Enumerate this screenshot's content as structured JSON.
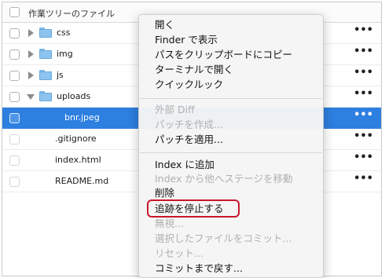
{
  "header": {
    "title": "作業ツリーのファイル"
  },
  "files": [
    {
      "name": "css",
      "type": "folder",
      "expanded": false
    },
    {
      "name": "img",
      "type": "folder",
      "expanded": false
    },
    {
      "name": "js",
      "type": "folder",
      "expanded": false
    },
    {
      "name": "uploads",
      "type": "folder",
      "expanded": true
    },
    {
      "name": "bnr.jpeg",
      "type": "file",
      "selected": true
    },
    {
      "name": ".gitignore",
      "type": "file"
    },
    {
      "name": "index.html",
      "type": "file"
    },
    {
      "name": "README.md",
      "type": "file"
    }
  ],
  "more_label": "•••",
  "context_menu": {
    "items": [
      {
        "label": "開く",
        "enabled": true
      },
      {
        "label": "Finder で表示",
        "enabled": true
      },
      {
        "label": "パスをクリップボードにコピー",
        "enabled": true
      },
      {
        "label": "ターミナルで開く",
        "enabled": true
      },
      {
        "label": "クイックルック",
        "enabled": true
      },
      {
        "label": "外部 Diff",
        "enabled": false
      },
      {
        "label": "パッチを作成...",
        "enabled": false
      },
      {
        "label": "パッチを適用...",
        "enabled": true
      },
      {
        "label": "Index に追加",
        "enabled": true
      },
      {
        "label": "Index から他へステージを移動",
        "enabled": false
      },
      {
        "label": "削除",
        "enabled": true
      },
      {
        "label": "追跡を停止する",
        "enabled": true,
        "highlighted": true
      },
      {
        "label": "無視...",
        "enabled": false
      },
      {
        "label": "選択したファイルをコミット...",
        "enabled": false
      },
      {
        "label": "リセット...",
        "enabled": false
      },
      {
        "label": "コミットまで戻す...",
        "enabled": true
      }
    ]
  },
  "colors": {
    "selection": "#2d7fe0",
    "highlight_border": "#c8172a",
    "folder": "#8cc4ef"
  }
}
